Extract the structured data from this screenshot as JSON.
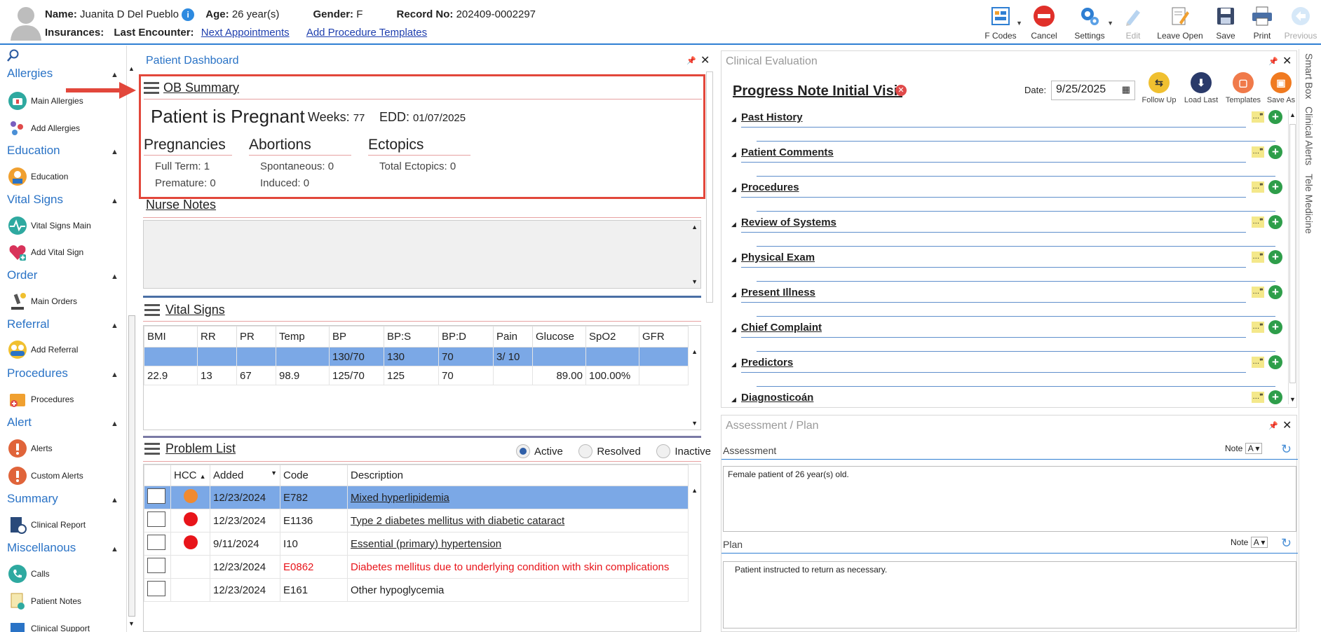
{
  "header": {
    "name_label": "Name:",
    "name_value": "Juanita D Del Pueblo",
    "age_label": "Age:",
    "age_value": "26 year(s)",
    "gender_label": "Gender:",
    "gender_value": "F",
    "record_label": "Record No:",
    "record_value": "202409-0002297",
    "insurances_label": "Insurances:",
    "last_encounter_label": "Last Encounter:",
    "next_appointments": "Next Appointments",
    "add_procedure_templates": "Add Procedure Templates"
  },
  "toolbar": {
    "fcodes": "F Codes",
    "cancel": "Cancel",
    "settings": "Settings",
    "edit": "Edit",
    "leave_open": "Leave Open",
    "save": "Save",
    "print": "Print",
    "previous": "Previous"
  },
  "nav": {
    "allergies": "Allergies",
    "main_allergies": "Main Allergies",
    "add_allergies": "Add Allergies",
    "education": "Education",
    "education_item": "Education",
    "vital_signs": "Vital Signs",
    "vital_signs_main": "Vital Signs Main",
    "add_vital_sign": "Add Vital Sign",
    "order": "Order",
    "main_orders": "Main Orders",
    "referral": "Referral",
    "add_referral": "Add Referral",
    "procedures": "Procedures",
    "procedures_item": "Procedures",
    "alert": "Alert",
    "alerts": "Alerts",
    "custom_alerts": "Custom Alerts",
    "summary": "Summary",
    "clinical_report": "Clinical Report",
    "miscellaneous": "Miscellanous",
    "calls": "Calls",
    "patient_notes": "Patient Notes",
    "clinical_support": "Clinical Support"
  },
  "dashboard": {
    "title": "Patient Dashboard",
    "ob": {
      "title": "OB Summary",
      "pregnant": "Patient is Pregnant",
      "weeks_label": "Weeks:",
      "weeks_value": "77",
      "edd_label": "EDD:",
      "edd_value": "01/07/2025",
      "pregnancies": "Pregnancies",
      "full_term": "Full Term: 1",
      "premature": "Premature: 0",
      "abortions": "Abortions",
      "spontaneous": "Spontaneous: 0",
      "induced": "Induced: 0",
      "ectopics": "Ectopics",
      "total_ectopics": "Total Ectopics: 0"
    },
    "nurse_notes": "Nurse Notes",
    "vitals": {
      "title": "Vital Signs",
      "headers": [
        "BMI",
        "RR",
        "PR",
        "Temp",
        "BP",
        "BP:S",
        "BP:D",
        "Pain",
        "Glucose",
        "SpO2",
        "GFR"
      ],
      "rows": [
        [
          "",
          "",
          "",
          "",
          "130/70",
          "130",
          "70",
          "3/ 10",
          "",
          "",
          ""
        ],
        [
          "22.9",
          "13",
          "67",
          "98.9",
          "125/70",
          "125",
          "70",
          "",
          "89.00",
          "100.00%",
          ""
        ]
      ]
    },
    "problems": {
      "title": "Problem List",
      "filter_active": "Active",
      "filter_resolved": "Resolved",
      "filter_inactive": "Inactive",
      "headers": [
        "HCC",
        "Added",
        "Code",
        "Description"
      ],
      "rows": [
        {
          "hcc": "orange",
          "added": "12/23/2024",
          "code": "E782",
          "desc": "Mixed hyperlipidemia"
        },
        {
          "hcc": "red",
          "added": "12/23/2024",
          "code": "E1136",
          "desc": "Type 2 diabetes mellitus with diabetic cataract"
        },
        {
          "hcc": "red",
          "added": "9/11/2024",
          "code": "I10",
          "desc": "Essential (primary) hypertension"
        },
        {
          "hcc": "",
          "added": "12/23/2024",
          "code": "E0862",
          "desc": "Diabetes mellitus due to underlying condition with skin complications"
        },
        {
          "hcc": "",
          "added": "12/23/2024",
          "code": "E161",
          "desc": "Other hypoglycemia"
        }
      ]
    }
  },
  "clinical": {
    "title": "Clinical Evaluation",
    "note_title": "Progress Note Initial Visit",
    "date_label": "Date:",
    "date_value": "9/25/2025",
    "follow_up": "Follow Up",
    "load_last": "Load Last",
    "templates": "Templates",
    "save_as": "Save As",
    "sections": [
      "Past History",
      "Patient Comments",
      "Procedures",
      "Review of Systems",
      "Physical Exam",
      "Present Illness",
      "Chief Complaint",
      "Predictors",
      "Diagnosticoán"
    ]
  },
  "assessment_plan": {
    "title": "Assessment / Plan",
    "assessment_label": "Assessment",
    "assessment_text": "Female patient of 26 year(s) old.",
    "plan_label": "Plan",
    "plan_text": "Patient instructed to return as necessary.",
    "note_label": "Note"
  },
  "right_tabs": {
    "smart_box": "Smart Box",
    "clinical_alerts": "Clinical Alerts",
    "tele_medicine": "Tele Medicine"
  },
  "colors": {
    "accent": "#2a73c6",
    "highlight_border": "#e2473b",
    "selected_row": "#7ba8e6"
  }
}
